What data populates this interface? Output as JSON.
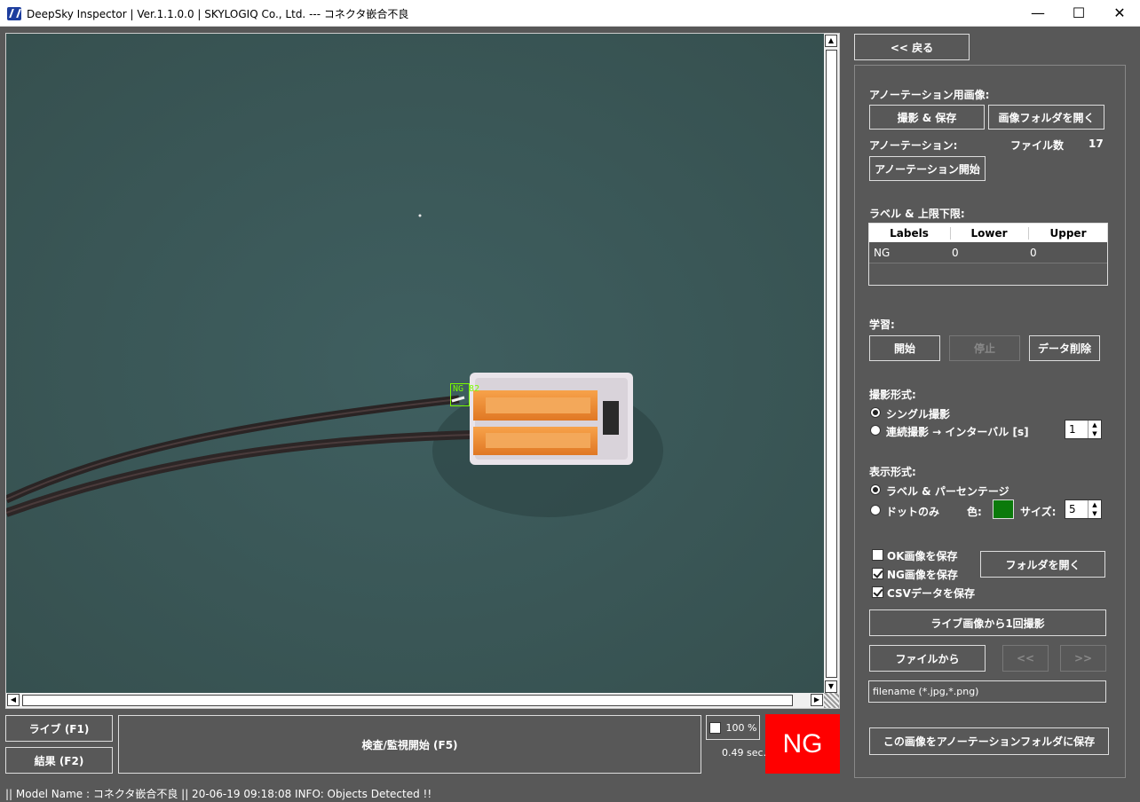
{
  "window": {
    "title": "DeepSky Inspector | Ver.1.1.0.0 | SKYLOGIQ Co., Ltd. --- コネクタ嵌合不良",
    "controls": {
      "minimize": "—",
      "maximize": "☐",
      "close": "✕"
    }
  },
  "viewer": {
    "detection_label": "NG 82",
    "detection_color": "#7cfc00"
  },
  "bottom": {
    "live_button": "ライブ (F1)",
    "result_button": "結果 (F2)",
    "inspect_button": "検査/監視開始 (F5)",
    "zoom_label": "100 %",
    "elapsed": "0.49 sec.",
    "judgement": "NG",
    "judgement_color": "#ff0000"
  },
  "status": {
    "text": "|| Model Name : コネクタ嵌合不良 ||    20-06-19 09:18:08   INFO:   Objects Detected !!"
  },
  "panel": {
    "back_button": "<< 戻る",
    "annotation_images_label": "アノーテーション用画像:",
    "capture_save_button": "撮影 & 保存",
    "open_image_folder_button": "画像フォルダを開く",
    "annotation_label": "アノーテーション:",
    "file_count_label": "ファイル数",
    "file_count": "17",
    "start_annotation_button": "アノーテーション開始",
    "labels_limits_label": "ラベル & 上限下限:",
    "table": {
      "headers": [
        "Labels",
        "Lower",
        "Upper"
      ],
      "rows": [
        [
          "NG",
          "0",
          "0"
        ]
      ]
    },
    "learning_label": "学習:",
    "learn_start": "開始",
    "learn_stop": "停止",
    "learn_delete": "データ削除",
    "capture_mode_label": "撮影形式:",
    "capture_single": "シングル撮影",
    "capture_continuous": "連続撮影 → インターバル [s]",
    "interval_value": "1",
    "display_mode_label": "表示形式:",
    "display_label_percent": "ラベル & パーセンテージ",
    "display_dots_only": "ドットのみ",
    "color_label": "色:",
    "dot_color": "#0b7a0b",
    "size_label": "サイズ:",
    "size_value": "5",
    "save_ok": "OK画像を保存",
    "save_ng": "NG画像を保存",
    "save_csv": "CSVデータを保存",
    "open_folder_button": "フォルダを開く",
    "capture_once_button": "ライブ画像から1回撮影",
    "from_file_button": "ファイルから",
    "prev_button": "<<",
    "next_button": ">>",
    "filename_value": "filename (*.jpg,*.png)",
    "save_to_annotation_button": "この画像をアノーテーションフォルダに保存"
  }
}
